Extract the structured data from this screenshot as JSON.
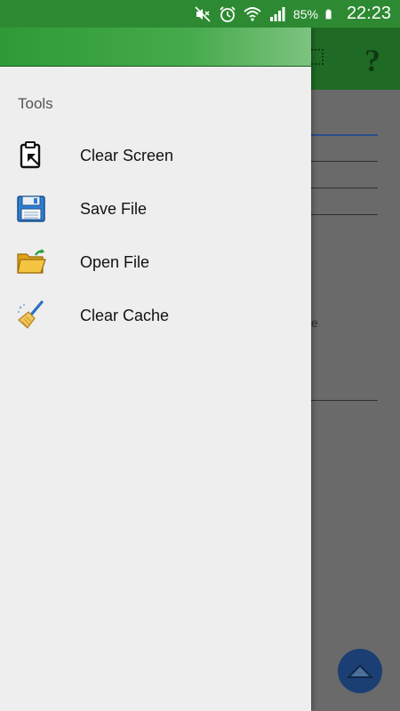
{
  "status_bar": {
    "battery_percent": "85%",
    "time": "22:23",
    "icons": [
      "mute-icon",
      "alarm-icon",
      "wifi-icon",
      "signal-icon",
      "battery-icon"
    ]
  },
  "app_bar": {
    "help_label": "?"
  },
  "background": {
    "fragment_text": "e"
  },
  "drawer": {
    "section_title": "Tools",
    "items": [
      {
        "label": "Clear Screen",
        "icon": "clipboard-icon"
      },
      {
        "label": "Save File",
        "icon": "floppy-disk-icon"
      },
      {
        "label": "Open File",
        "icon": "open-folder-icon"
      },
      {
        "label": "Clear Cache",
        "icon": "broom-icon"
      }
    ]
  },
  "colors": {
    "status_bar": "#2d8a32",
    "drawer_header": "#45aa4b",
    "drawer_bg": "#eeeeee",
    "fab": "#1b3f73"
  }
}
